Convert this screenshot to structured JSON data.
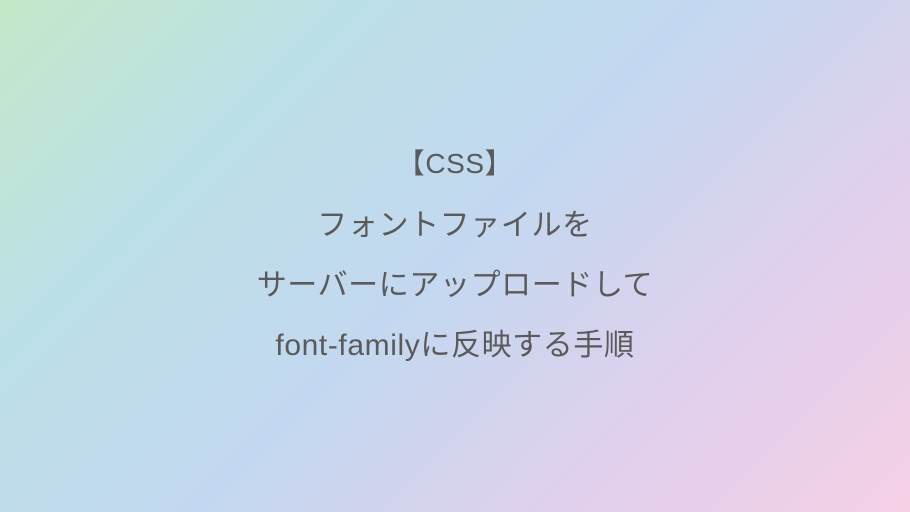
{
  "title": {
    "line1": "【CSS】",
    "line2": "フォントファイルを",
    "line3": "サーバーにアップロードして",
    "line4": "font-familyに反映する手順"
  }
}
